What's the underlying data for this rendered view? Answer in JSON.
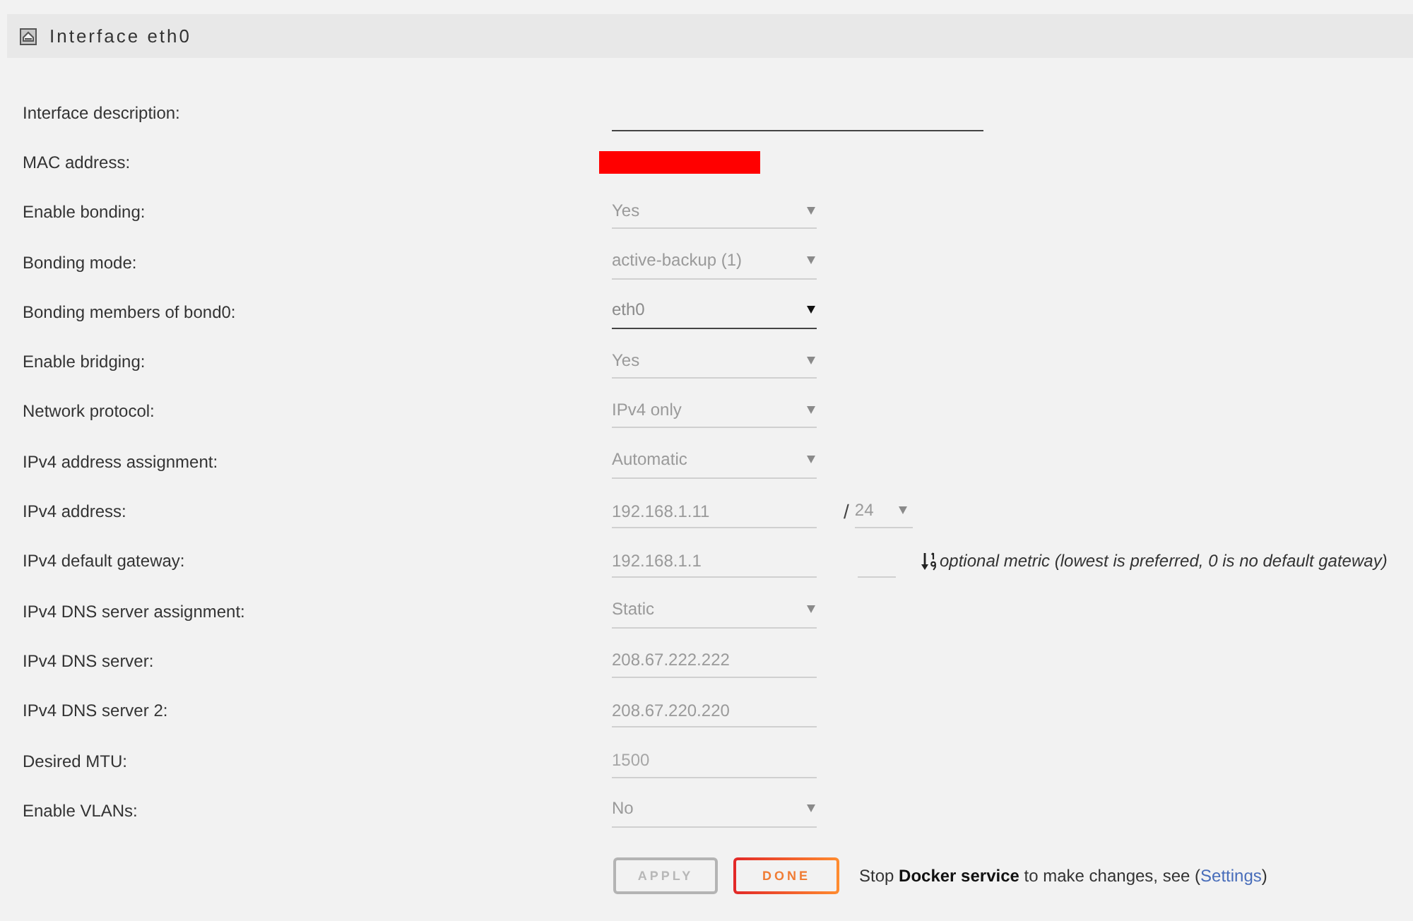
{
  "panel": {
    "title": "Interface eth0"
  },
  "fields": [
    {
      "label": "Interface description:",
      "kind": "long",
      "disabled": false
    },
    {
      "label": "MAC address:",
      "kind": "redacted"
    },
    {
      "label": "Enable bonding:",
      "kind": "select",
      "value": "Yes",
      "disabled": true
    },
    {
      "label": "Bonding mode:",
      "kind": "select",
      "value": "active-backup (1)",
      "disabled": true
    },
    {
      "label": "Bonding members of bond0:",
      "kind": "select",
      "value": "eth0",
      "disabled": false
    },
    {
      "label": "Enable bridging:",
      "kind": "select",
      "value": "Yes",
      "disabled": true
    },
    {
      "label": "Network protocol:",
      "kind": "select",
      "value": "IPv4 only",
      "disabled": true
    },
    {
      "label": "IPv4 address assignment:",
      "kind": "select",
      "value": "Automatic",
      "disabled": true
    },
    {
      "label": "IPv4 address:",
      "kind": "text",
      "value": "192.168.1.11",
      "disabled": true,
      "extras": [
        {
          "kind": "separator",
          "text": "/"
        },
        {
          "kind": "select",
          "value": "24",
          "disabled": true
        }
      ]
    },
    {
      "label": "IPv4 default gateway:",
      "kind": "text",
      "value": "192.168.1.1",
      "disabled": true,
      "extras": [
        {
          "kind": "text",
          "disabled": true
        },
        {
          "kind": "note",
          "text": "optional metric (lowest is preferred, 0 is no default gateway)"
        }
      ]
    },
    {
      "label": "IPv4 DNS server assignment:",
      "kind": "select",
      "value": "Static",
      "disabled": true
    },
    {
      "label": "IPv4 DNS server:",
      "kind": "text",
      "value": "208.67.222.222",
      "disabled": true
    },
    {
      "label": "IPv4 DNS server 2:",
      "kind": "text",
      "value": "208.67.220.220",
      "disabled": true
    },
    {
      "label": "Desired MTU:",
      "kind": "text",
      "placeholder": "1500",
      "disabled": true
    },
    {
      "label": "Enable VLANs:",
      "kind": "select",
      "value": "No",
      "disabled": true
    }
  ],
  "buttons": [
    {
      "label": "APPLY",
      "disabled": true
    },
    {
      "label": "DONE",
      "disabled": false
    }
  ],
  "notice": {
    "text": "Stop **Docker service** to make changes, see (",
    "link": "Settings",
    "closing": ")"
  }
}
